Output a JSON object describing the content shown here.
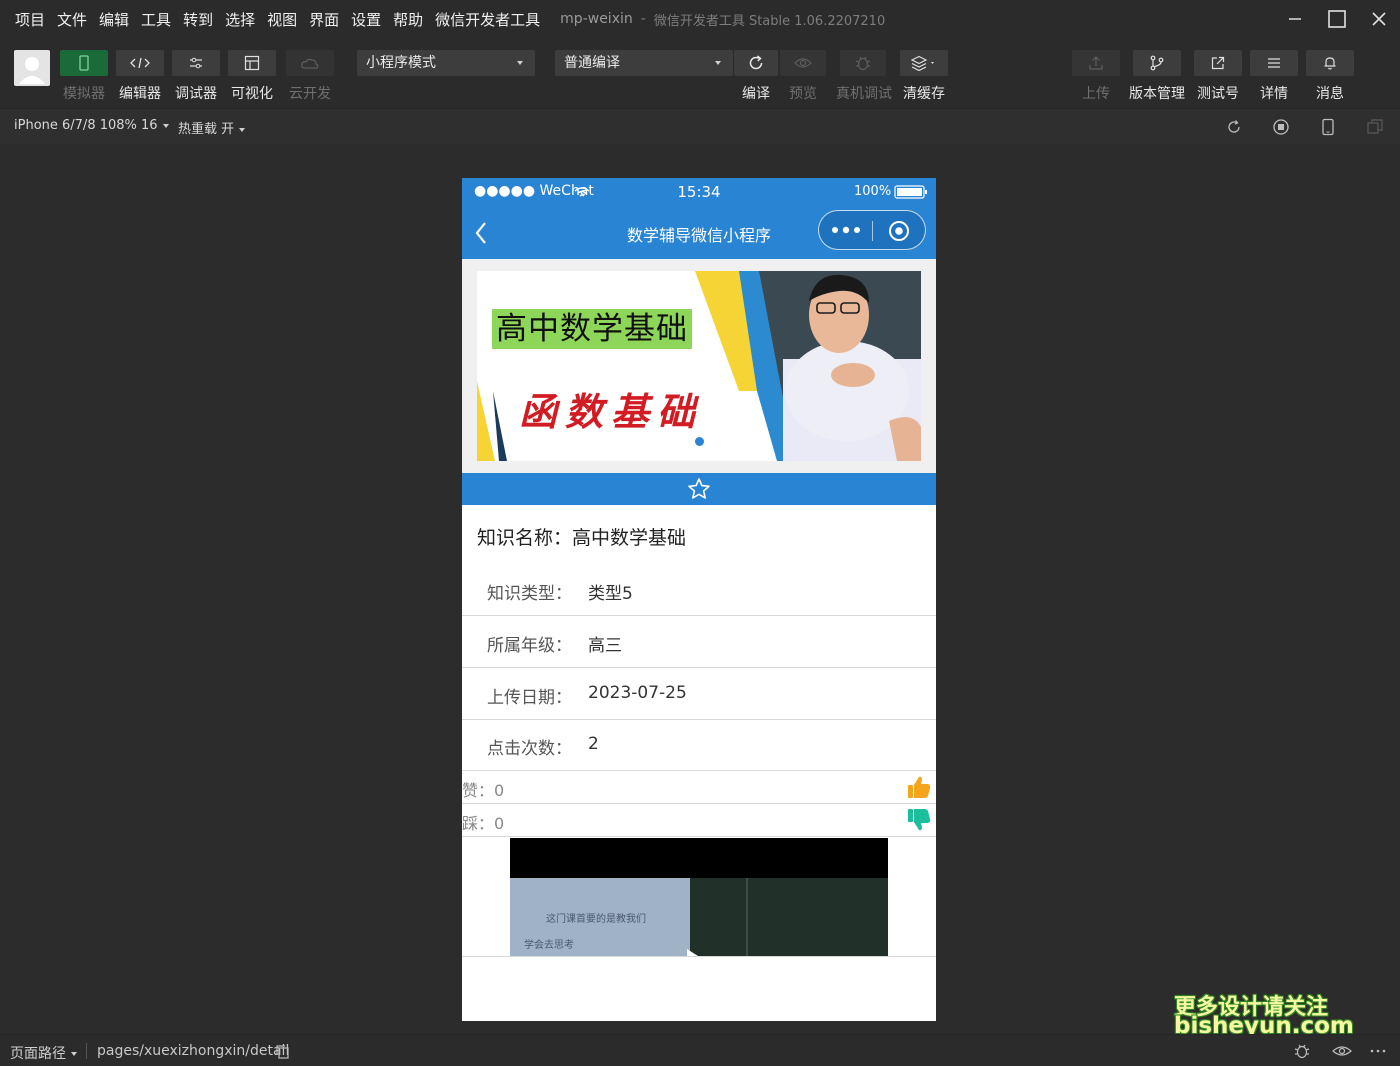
{
  "menubar": {
    "items": [
      "项目",
      "文件",
      "编辑",
      "工具",
      "转到",
      "选择",
      "视图",
      "界面",
      "设置",
      "帮助",
      "微信开发者工具"
    ],
    "app_name": "mp-weixin",
    "separator": "-",
    "app_version": "微信开发者工具 Stable 1.06.2207210"
  },
  "toolbar": {
    "simulator": "模拟器",
    "editor": "编辑器",
    "debugger": "调试器",
    "visual": "可视化",
    "cloud": "云开发",
    "mode_select": "小程序模式",
    "compile_select": "普通编译",
    "compile": "编译",
    "preview": "预览",
    "real_debug": "真机调试",
    "clear_cache": "清缓存",
    "upload": "上传",
    "version_mgmt": "版本管理",
    "test_account": "测试号",
    "details": "详情",
    "messages": "消息"
  },
  "subbar": {
    "device": "iPhone 6/7/8 108% 16",
    "hot_reload": "热重载 开"
  },
  "phone": {
    "carrier": "●●●●● WeChat",
    "time": "15:34",
    "battery": "100%",
    "nav_title": "数学辅导微信小程序",
    "banner_title": "高中数学基础",
    "banner_subtitle": "函数基础",
    "knowledge_name_label": "知识名称：",
    "knowledge_name": "高中数学基础",
    "rows": [
      {
        "label": "知识类型：",
        "value": "类型5"
      },
      {
        "label": "所属年级：",
        "value": "高三"
      },
      {
        "label": "上传日期：",
        "value": "2023-07-25"
      },
      {
        "label": "点击次数：",
        "value": "2"
      }
    ],
    "likes_label": "赞：",
    "likes": "0",
    "dislikes_label": "踩：",
    "dislikes": "0",
    "video_line1": "这门课首要的是教我们",
    "video_line2": "学会去思考"
  },
  "watermark": {
    "line1": "更多设计请关注",
    "line2": "bisheyun.com"
  },
  "bottombar": {
    "page_path_label": "页面路径",
    "path": "pages/xuexizhongxin/detail"
  },
  "colors": {
    "primary_blue": "#2a84d4",
    "active_green": "#1a6a3a",
    "like_orange": "#f3a51c",
    "dislike_teal": "#1bbf9e"
  }
}
